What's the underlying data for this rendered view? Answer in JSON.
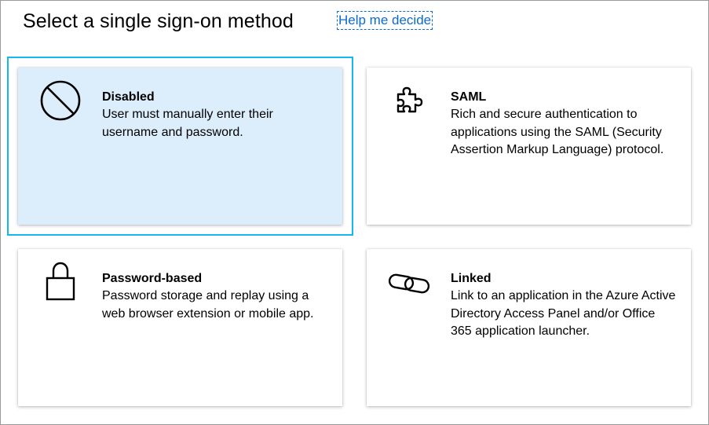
{
  "header": {
    "title": "Select a single sign-on method",
    "help_link": "Help me decide"
  },
  "accent_color": "#13b8ec",
  "selected_tile_color": "#dcedfc",
  "link_color": "#0b6bc8",
  "tiles": [
    {
      "id": "disabled",
      "icon": "prohibited-icon",
      "title": "Disabled",
      "description": "User must manually enter their username and password.",
      "selected": true
    },
    {
      "id": "saml",
      "icon": "puzzle-piece-icon",
      "title": "SAML",
      "description": "Rich and secure authentication to applications using the SAML (Security Assertion Markup Language) protocol.",
      "selected": false
    },
    {
      "id": "password",
      "icon": "padlock-icon",
      "title": "Password-based",
      "description": "Password storage and replay using a web browser extension or mobile app.",
      "selected": false
    },
    {
      "id": "linked",
      "icon": "chain-link-icon",
      "title": "Linked",
      "description": "Link to an application in the Azure Active Directory Access Panel and/or Office 365 application launcher.",
      "selected": false
    }
  ]
}
